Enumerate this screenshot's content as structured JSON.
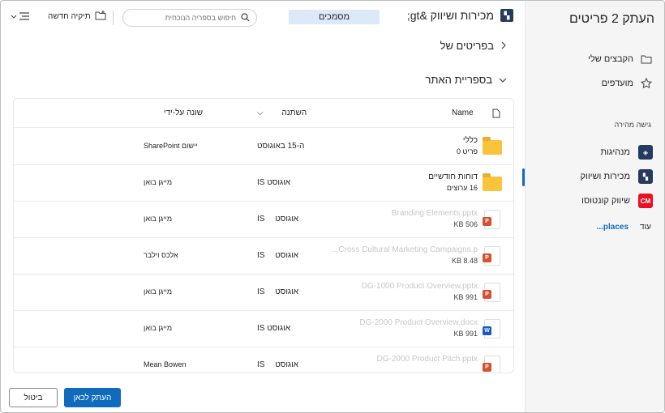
{
  "sidebar": {
    "title": "העתק 2 פריטים",
    "my_files": "הקבצים שלי",
    "favorites": "מועדפים",
    "quick_access_label": "גישה מהירה",
    "sites": [
      {
        "label": "מנהיגות",
        "tile_color": "#243a5e",
        "tile_text": "◈"
      },
      {
        "label": "מכירות ושיווק",
        "tile_color": "#243a5e",
        "tile_text": "▚"
      },
      {
        "label": "שיווק קונטוסו",
        "tile_color": "#e81123",
        "tile_text": "CM"
      }
    ],
    "more_label": "עוד",
    "more_link": "places..."
  },
  "header": {
    "site_title": "מכירות ושיווק &gt;",
    "doc_tab": "מסמכים",
    "search_placeholder": "חיפוש בספריה הנוכחית",
    "new_folder": "תיקיה חדשה"
  },
  "sections": {
    "my_items": "בפריטים של",
    "this_library": "בספריית האתר"
  },
  "table": {
    "columns": {
      "name": "Name",
      "modified": "השתנה",
      "modified_by": "שונה על-ידי"
    },
    "rows": [
      {
        "type": "folder",
        "name": "כללי",
        "sub": "פריט 0",
        "modified": "ה-15 באוגוסט",
        "modified_by": "יישום SharePoint",
        "dim": false
      },
      {
        "type": "folder",
        "name": "דוחות חודשיים",
        "sub": "16 ערוצים",
        "modified": "אוגוסט IS",
        "modified_by": "מייגן בואן",
        "dim": false
      },
      {
        "type": "pptx",
        "name": "Branding Elements.pptx",
        "sub": "506 KB",
        "modified": "אוגוסט",
        "modified_extra": "IS",
        "modified_by": "מייגן בואן",
        "dim": true
      },
      {
        "type": "pptx",
        "name": "Cross Cultural Marketing Campaigns.p...",
        "sub": "8.48 KB",
        "modified": "אוגוסט",
        "modified_extra": "IS",
        "modified_by": "אלכס וילבר",
        "dim": true
      },
      {
        "type": "pptx",
        "name": "DG-1000 Product Overview.pptx",
        "sub": "991 KB",
        "modified": "אוגוסט",
        "modified_extra": "IS",
        "modified_by": "מייגן בואן",
        "dim": true
      },
      {
        "type": "docx",
        "name": "DG-2000 Product Overview.docx",
        "sub": "991 KB",
        "modified": "אוגוסט IS",
        "modified_by": "מייגן בואן",
        "dim": true
      },
      {
        "type": "pptx",
        "name": "DG-2000 Product Pitch.pptx",
        "sub": "",
        "modified": "אוגוסט",
        "modified_extra": "IS",
        "modified_by": "Mean Bowen",
        "dim": true
      }
    ]
  },
  "footer": {
    "copy_here": "העתק לכאן",
    "cancel": "ביטול"
  },
  "colors": {
    "accent": "#0f6cbd",
    "folder": "#f9c33b",
    "ppt": "#d35230",
    "word": "#185abd"
  }
}
